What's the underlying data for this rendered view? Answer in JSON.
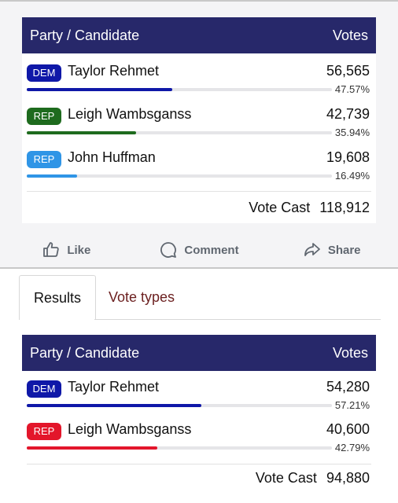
{
  "post": {
    "results_table": {
      "header": {
        "col1": "Party / Candidate",
        "col2": "Votes"
      },
      "rows": [
        {
          "party": "DEM",
          "party_color": "#0f18a8",
          "name": "Taylor Rehmet",
          "votes": "56,565",
          "percent": "47.57%",
          "share": 0.4757,
          "bar_color": "#0f18a8"
        },
        {
          "party": "REP",
          "party_color": "#1e6b1e",
          "name": "Leigh Wambsganss",
          "votes": "42,739",
          "percent": "35.94%",
          "share": 0.3594,
          "bar_color": "#1e6b1e"
        },
        {
          "party": "REP",
          "party_color": "#2f95e6",
          "name": "John Huffman",
          "votes": "19,608",
          "percent": "16.49%",
          "share": 0.1649,
          "bar_color": "#2f95e6"
        }
      ],
      "total_label": "Vote Cast",
      "total_value": "118,912"
    },
    "actions": {
      "like": "Like",
      "comment": "Comment",
      "share": "Share"
    }
  },
  "tabs": {
    "active": "Results",
    "other": "Vote types"
  },
  "results_table_2": {
    "header": {
      "col1": "Party / Candidate",
      "col2": "Votes"
    },
    "rows": [
      {
        "party": "DEM",
        "party_color": "#0f18a8",
        "name": "Taylor Rehmet",
        "votes": "54,280",
        "percent": "57.21%",
        "share": 0.5721,
        "bar_color": "#0f18a8"
      },
      {
        "party": "REP",
        "party_color": "#e3162b",
        "name": "Leigh Wambsganss",
        "votes": "40,600",
        "percent": "42.79%",
        "share": 0.4279,
        "bar_color": "#e3162b"
      }
    ],
    "total_label": "Vote Cast",
    "total_value": "94,880"
  }
}
